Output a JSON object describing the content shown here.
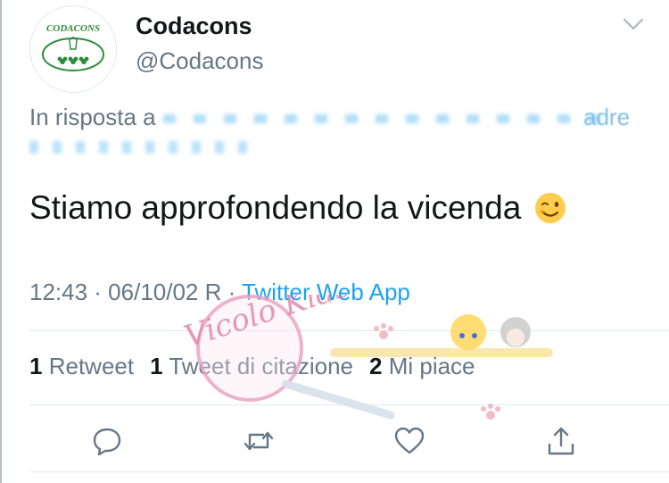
{
  "account": {
    "logo_text": "CODACONS",
    "display_name": "Codacons",
    "handle": "@Codacons"
  },
  "reply": {
    "prefix": "In risposta a",
    "visible_tail": "adre"
  },
  "tweet": {
    "text": "Stiamo approfondendo la vicenda",
    "emoji": "winking-face"
  },
  "meta": {
    "time_date": "12:43 · 06/10/02 R",
    "separator": " · ",
    "app": "Twitter Web App"
  },
  "stats": {
    "retweets_count": "1",
    "retweets_label": "Retweet",
    "quotes_count": "1",
    "quotes_label": "Tweet di citazione",
    "likes_count": "2",
    "likes_label": "Mi piace"
  },
  "actions": [
    "reply-icon",
    "retweet-icon",
    "like-icon",
    "share-icon"
  ],
  "watermark": {
    "script_text": "Vicolo Kids"
  },
  "colors": {
    "text": "#14171a",
    "secondary": "#657786",
    "link": "#1da1f2",
    "logo_green": "#2e8b3d",
    "divider": "#e1e8ed"
  }
}
